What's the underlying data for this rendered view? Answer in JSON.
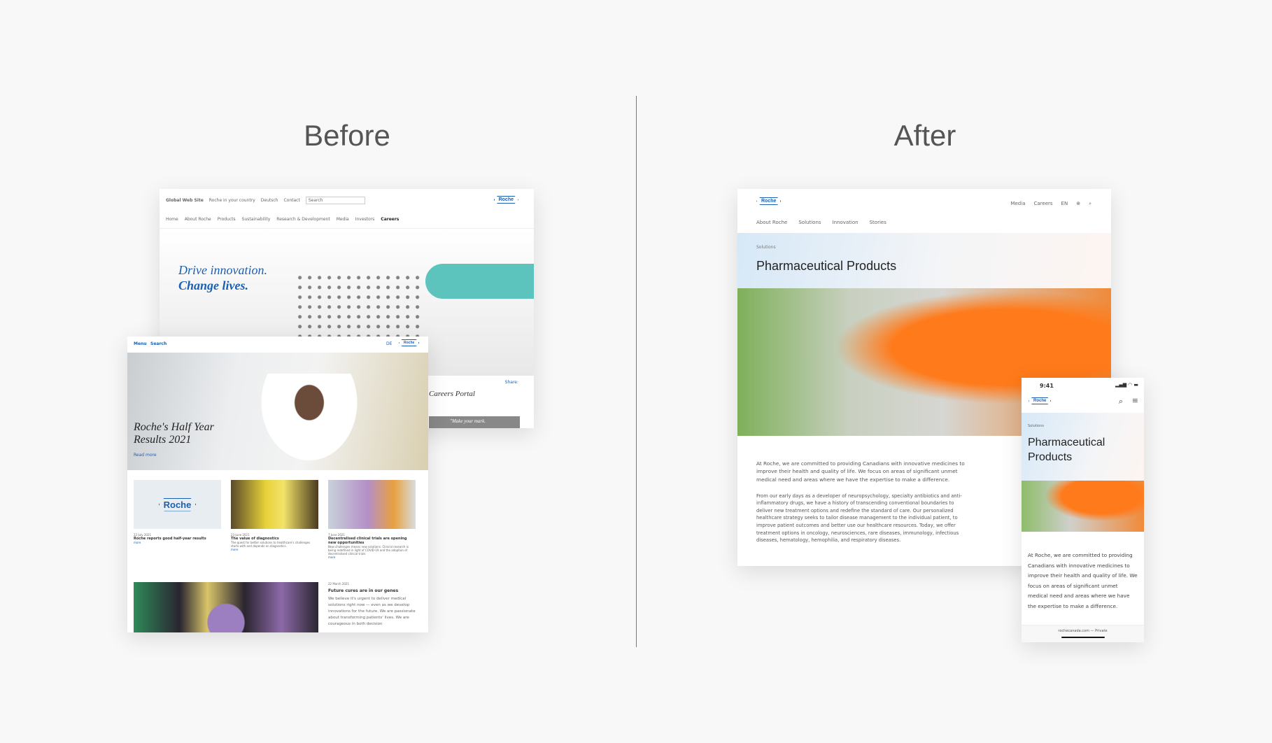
{
  "labels": {
    "before": "Before",
    "after": "After"
  },
  "before_desktop": {
    "top_links": [
      "Global Web Site",
      "Roche in your country",
      "Deutsch",
      "Contact"
    ],
    "search_placeholder": "Search",
    "logo": "Roche",
    "nav": [
      "Home",
      "About Roche",
      "Products",
      "Sustainability",
      "Research & Development",
      "Media",
      "Investors",
      "Careers"
    ],
    "hero_line1": "Drive innovation.",
    "hero_line2": "Change lives.",
    "share_label": "Share:",
    "careers_portal": "Careers Portal",
    "careers_quote": "\"Make your mark."
  },
  "before_tablet": {
    "menu": "Menu",
    "search": "Search",
    "lang": "DE",
    "logo": "Roche",
    "hero_title": "Roche's Half Year Results 2021",
    "read_more": "Read more",
    "cards": [
      {
        "date": "22 July 2021",
        "title": "Roche reports good half-year results",
        "desc": "",
        "more": "more"
      },
      {
        "date": "23 June 2021",
        "title": "The value of diagnostics",
        "desc": "The quest for better solutions to healthcare's challenges starts with and depends on diagnostics.",
        "more": "more"
      },
      {
        "date": "7 June 2021",
        "title": "Decentralised clinical trials are opening new opportunities",
        "desc": "New challenges means new solutions. Clinical research is being redefined in light of COVID-19 and the adoption of decentralised clinical trials",
        "more": "more"
      }
    ],
    "feature": {
      "date": "22 March 2021",
      "title": "Future cures are in our genes",
      "desc": "We believe it's urgent to deliver medical solutions right now — even as we develop innovations for the future. We are passionate about transforming patients' lives. We are courageous in both decision"
    }
  },
  "after_desktop": {
    "logo": "Roche",
    "utility": [
      "Media",
      "Careers"
    ],
    "lang": "EN",
    "nav": [
      "About Roche",
      "Solutions",
      "Innovation",
      "Stories"
    ],
    "breadcrumb": "Solutions",
    "title": "Pharmaceutical Products",
    "para1": "At Roche, we are committed to providing Canadians with innovative medicines to improve their health and quality of life. We focus on areas of significant unmet medical need and areas where we have the expertise to make a difference.",
    "para2": "From our early days as a developer of neuropsychology, specialty antibiotics and anti-inflammatory drugs, we have a history of transcending conventional boundaries to deliver new treatment options and redefine the standard of care. Our personalized healthcare strategy seeks to tailor disease management to the individual patient, to improve patient outcomes and better use our healthcare resources. Today, we offer treatment options in oncology, neurosciences, rare diseases, immunology, infectious diseases, hematology, hemophilia, and respiratory diseases."
  },
  "after_phone": {
    "time": "9:41",
    "logo": "Roche",
    "breadcrumb": "Solutions",
    "title": "Pharmaceutical Products",
    "para": "At Roche, we are committed to providing Canadians with innovative medicines to improve their health and quality of life. We focus on areas of significant unmet medical need and areas where we have the expertise to make a difference.",
    "url": "rochecanada.com — Private"
  }
}
